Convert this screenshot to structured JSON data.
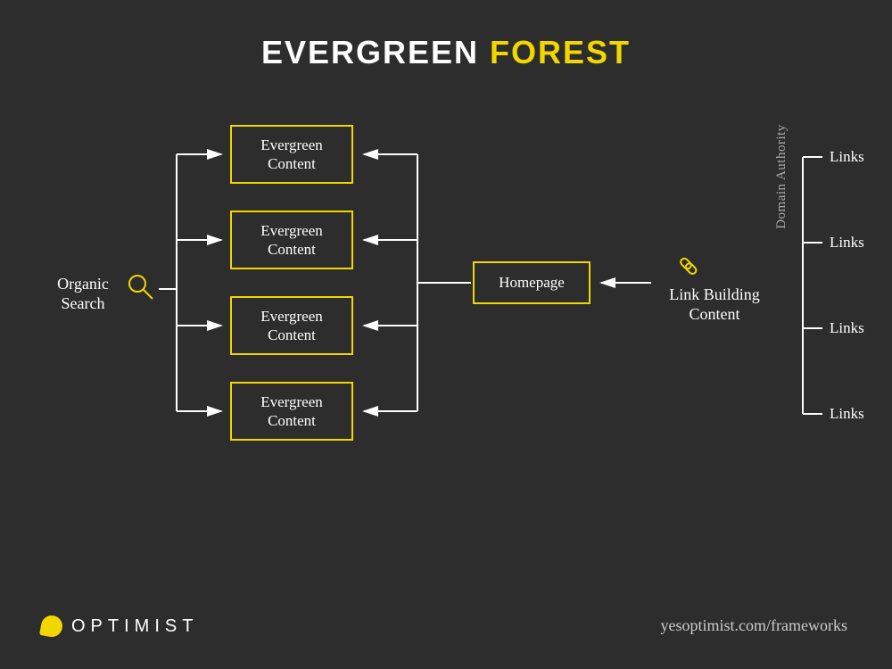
{
  "title": {
    "word1": "EVERGREEN",
    "word2": "FOREST"
  },
  "organic_search": "Organic Search",
  "evergreen_boxes": [
    "Evergreen Content",
    "Evergreen Content",
    "Evergreen Content",
    "Evergreen Content"
  ],
  "homepage": "Homepage",
  "link_building": "Link Building Content",
  "domain_authority": "Domain Authority",
  "links_labels": [
    "Links",
    "Links",
    "Links",
    "Links"
  ],
  "brand": "OPTIMIST",
  "url": "yesoptimist.com/frameworks",
  "colors": {
    "accent": "#f2d600",
    "bg": "#2d2d2d"
  }
}
